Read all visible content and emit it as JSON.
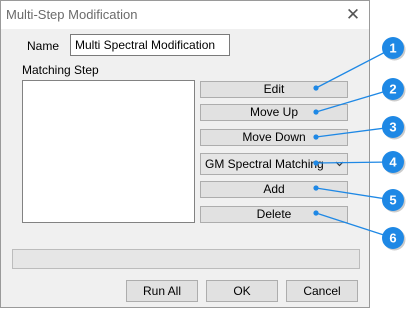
{
  "window": {
    "title": "Multi-Step Modification",
    "close_glyph": "✕"
  },
  "form": {
    "name_label": "Name",
    "name_value": "Multi Spectral Modification",
    "matching_step_label": "Matching Step",
    "matching_steps": []
  },
  "side_buttons": {
    "edit": "Edit",
    "move_up": "Move Up",
    "move_down": "Move Down",
    "method_select": "GM Spectral Matching",
    "add": "Add",
    "delete": "Delete"
  },
  "progress": {
    "value": 0
  },
  "bottom_buttons": {
    "run_all": "Run All",
    "ok": "OK",
    "cancel": "Cancel"
  },
  "callouts": {
    "labels": [
      "1",
      "2",
      "3",
      "4",
      "5",
      "6"
    ],
    "color": "#1e88e5"
  },
  "icons": {
    "close": "close-icon",
    "dropdown": "chevron-down-icon"
  }
}
